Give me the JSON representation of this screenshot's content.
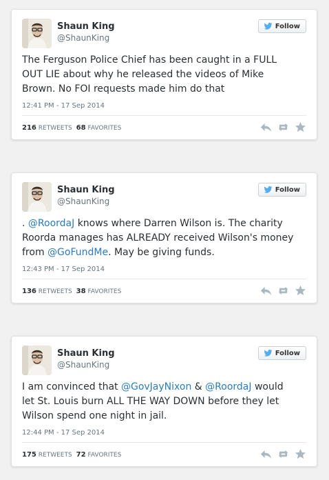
{
  "colors": {
    "link": "#2b7bb9",
    "text": "#292f33",
    "muted": "#66757f",
    "bird": "#55acee",
    "action_icon": "#aab8c2"
  },
  "follow_label": "Follow",
  "tweets": [
    {
      "name": "Shaun King",
      "handle": "@ShaunKing",
      "text": [
        "The Ferguson Police Chief has been caught in a FULL OUT LIE about why he released the videos of Mike Brown. No FOI requests made him do that"
      ],
      "timestamp": "12:41 PM - 17 Sep 2014",
      "retweets": "216",
      "retweets_label": "RETWEETS",
      "favorites": "68",
      "favorites_label": "FAVORITES"
    },
    {
      "name": "Shaun King",
      "handle": "@ShaunKing",
      "text": [
        ". ",
        "@RoordaJ",
        " knows where Darren Wilson is. The charity Roorda manages has ALREADY received Wilson's money from ",
        "@GoFundMe",
        ". May be giving funds."
      ],
      "timestamp": "12:43 PM - 17 Sep 2014",
      "retweets": "136",
      "retweets_label": "RETWEETS",
      "favorites": "38",
      "favorites_label": "FAVORITES"
    },
    {
      "name": "Shaun King",
      "handle": "@ShaunKing",
      "text": [
        "I am convinced that ",
        "@GovJayNixon",
        " & ",
        "@RoordaJ",
        " would let St. Louis burn ALL THE WAY DOWN before they let Wilson spend one night in jail."
      ],
      "timestamp": "12:44 PM - 17 Sep 2014",
      "retweets": "175",
      "retweets_label": "RETWEETS",
      "favorites": "72",
      "favorites_label": "FAVORITES"
    }
  ]
}
